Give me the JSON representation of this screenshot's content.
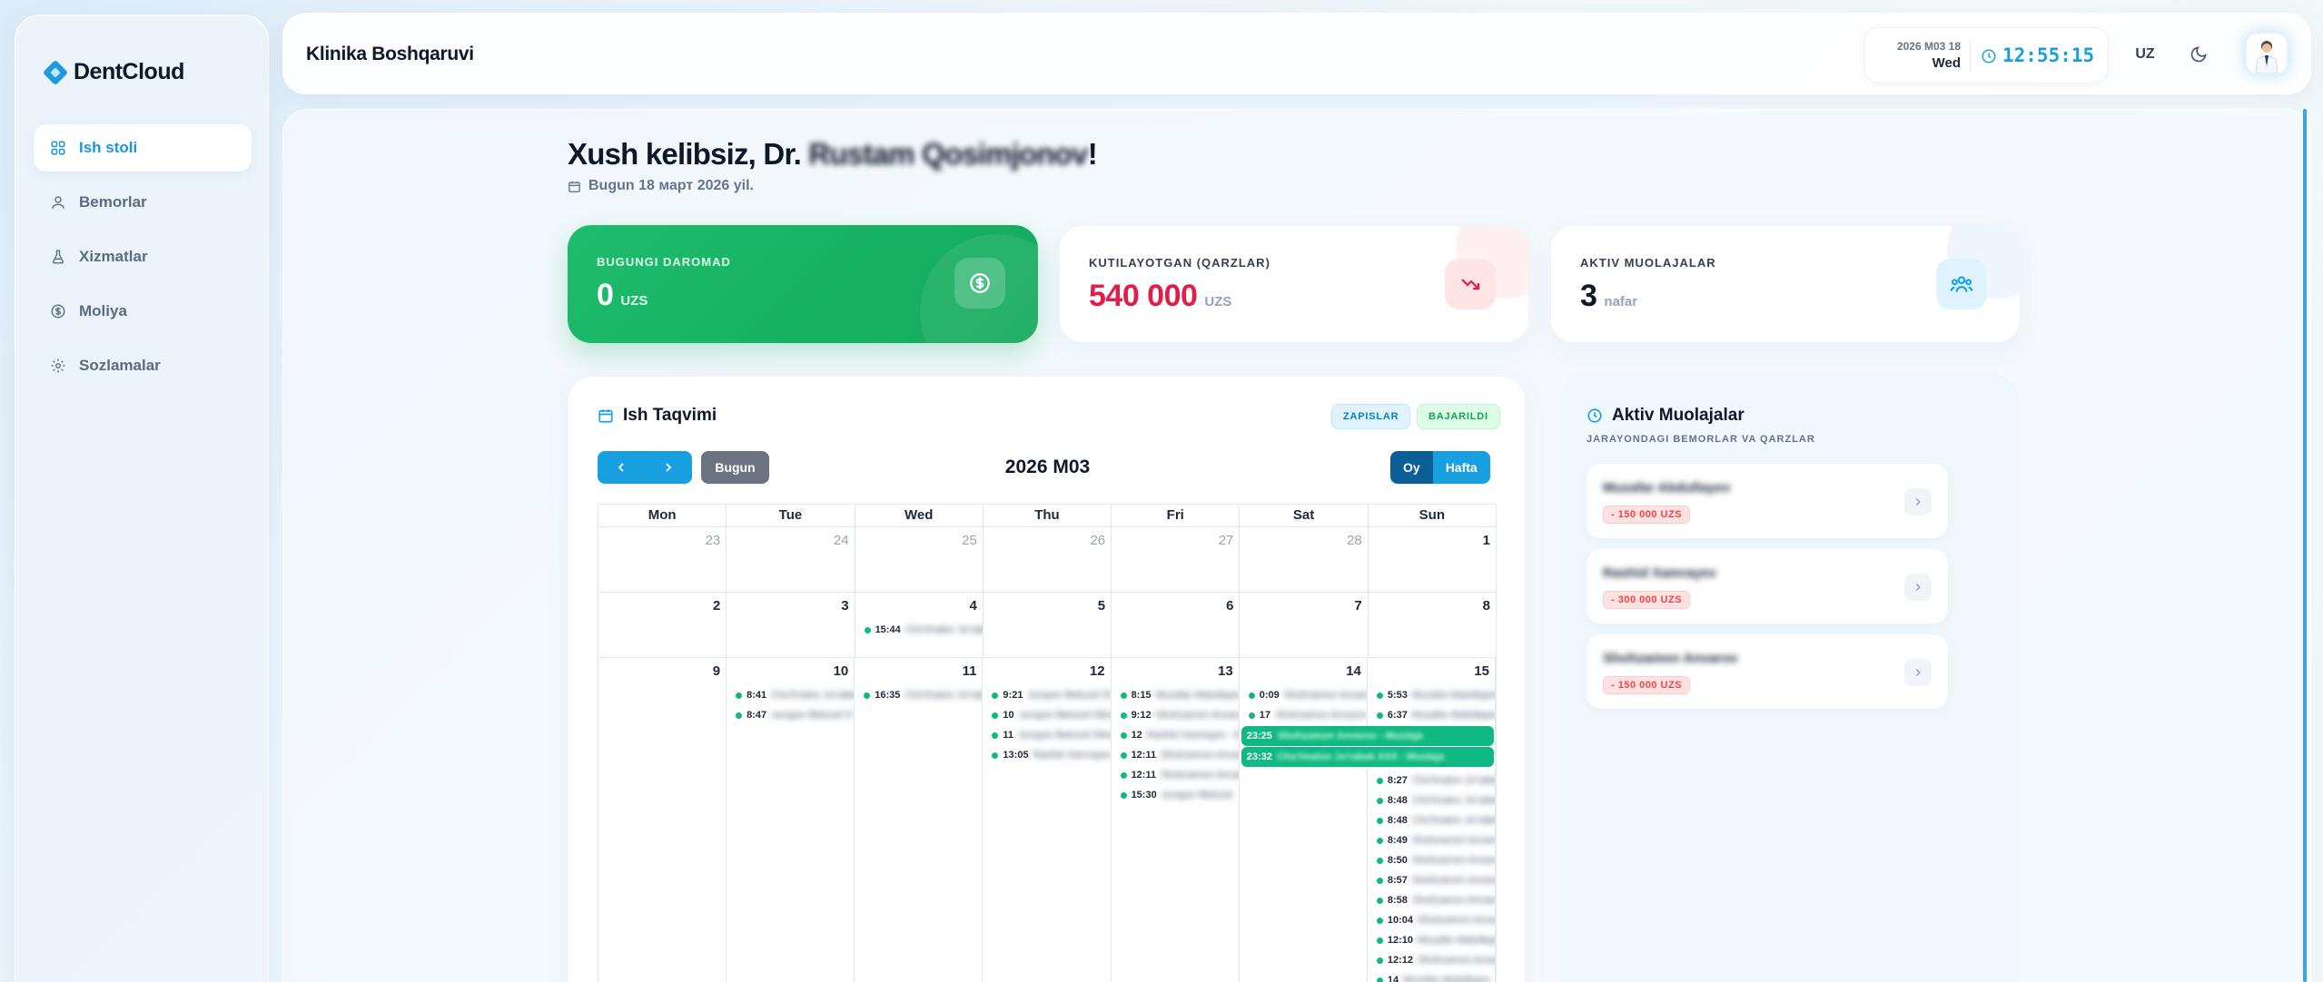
{
  "brand": {
    "name": "DentCloud"
  },
  "sidebar": {
    "items": [
      {
        "label": "Ish stoli",
        "icon": "dashboard-icon",
        "active": true
      },
      {
        "label": "Bemorlar",
        "icon": "users-icon"
      },
      {
        "label": "Xizmatlar",
        "icon": "flask-icon"
      },
      {
        "label": "Moliya",
        "icon": "dollar-icon"
      },
      {
        "label": "Sozlamalar",
        "icon": "gear-icon"
      }
    ]
  },
  "header": {
    "title": "Klinika Boshqaruvi",
    "date_line": "2026 M03 18",
    "weekday": "Wed",
    "time": "12:55:15",
    "lang": "UZ"
  },
  "welcome": {
    "prefix": "Xush kelibsiz, Dr. ",
    "name": "Rustam Qosimjonov",
    "suffix": "!",
    "today": "Bugun 18 март 2026 yil."
  },
  "stats": [
    {
      "label": "BUGUNGI DAROMAD",
      "value": "0",
      "unit": "UZS",
      "color": "#16b263"
    },
    {
      "label": "KUTILAYOTGAN (QARZLAR)",
      "value": "540 000",
      "unit": "UZS",
      "color": "#e11d48"
    },
    {
      "label": "AKTIV MUOLAJALAR",
      "value": "3",
      "unit": "nafar",
      "color": "#0f172a"
    }
  ],
  "calendar": {
    "title": "Ish Taqvimi",
    "legend_zapislar": "ZAPISLAR",
    "legend_bajarildi": "BAJARILDI",
    "today_btn": "Bugun",
    "month": "2026 M03",
    "view_month": "Oy",
    "view_week": "Hafta",
    "weekdays": [
      "Mon",
      "Tue",
      "Wed",
      "Thu",
      "Fri",
      "Sat",
      "Sun"
    ],
    "weeks": [
      {
        "days": [
          {
            "n": "23",
            "muted": true,
            "events": []
          },
          {
            "n": "24",
            "muted": true,
            "events": []
          },
          {
            "n": "25",
            "muted": true,
            "events": []
          },
          {
            "n": "26",
            "muted": true,
            "events": []
          },
          {
            "n": "27",
            "muted": true,
            "events": []
          },
          {
            "n": "28",
            "muted": true,
            "events": []
          },
          {
            "n": "1",
            "events": []
          }
        ]
      },
      {
        "days": [
          {
            "n": "2",
            "events": []
          },
          {
            "n": "3",
            "events": []
          },
          {
            "n": "4",
            "events": [
              {
                "t": "15:44",
                "n": "Cho'lmatov Jo'rabek"
              }
            ]
          },
          {
            "n": "5",
            "events": []
          },
          {
            "n": "6",
            "events": []
          },
          {
            "n": "7",
            "events": []
          },
          {
            "n": "8",
            "events": []
          }
        ]
      },
      {
        "days": [
          {
            "n": "9",
            "events": []
          },
          {
            "n": "10",
            "events": [
              {
                "t": "8:41",
                "n": "Cho'lmatov Jo'rabek"
              },
              {
                "t": "8:47",
                "n": "Jurayev Bekzod O"
              }
            ]
          },
          {
            "n": "11",
            "events": [
              {
                "t": "16:35",
                "n": "Cho'lmatov Jo'rabek"
              }
            ]
          },
          {
            "n": "12",
            "events": [
              {
                "t": "9:21",
                "n": "Jurayev Bekzod Ol"
              },
              {
                "t": "10",
                "n": "Jurayev Bekzod Olimovich"
              },
              {
                "t": "11",
                "n": "Jurayev Bekzod Olimovich"
              },
              {
                "t": "13:05",
                "n": "Rashid Xamrayev"
              }
            ]
          },
          {
            "n": "13",
            "events": [
              {
                "t": "8:15",
                "n": "Muzafar Abdullayev"
              },
              {
                "t": "9:12",
                "n": "Shohzamon Anvarov"
              },
              {
                "t": "12",
                "n": "Rashid Xamrayev - M"
              },
              {
                "t": "12:11",
                "n": "Shohzamon Anvarov"
              },
              {
                "t": "12:11",
                "n": "Shohzamon Anvarov"
              },
              {
                "t": "15:30",
                "n": "Jurayev Bekzod"
              }
            ]
          },
          {
            "n": "14",
            "events": [
              {
                "t": "0:09",
                "n": "Shohzamon Anvarov"
              },
              {
                "t": "17",
                "n": "Shohzamon Anvarov"
              }
            ]
          },
          {
            "n": "15",
            "events": [
              {
                "t": "5:53",
                "n": "Muzafar Abdullayev"
              },
              {
                "t": "6:37",
                "n": "Muzafar Abdullayev"
              }
            ]
          }
        ],
        "bars": [
          {
            "t": "23:25",
            "n": "Shohzamon Anvarov - Muolaja"
          },
          {
            "t": "23:32",
            "n": "Cho'lmatov Jo'rabek XXX - Muolaja"
          }
        ],
        "sun_more": [
          {
            "t": "8:27",
            "n": "Cho'lmatov Jo'rabek"
          },
          {
            "t": "8:48",
            "n": "Cho'lmatov Jo'rabek"
          },
          {
            "t": "8:48",
            "n": "Cho'lmatov Jo'rabek"
          },
          {
            "t": "8:49",
            "n": "Shohzamon Anvarov"
          },
          {
            "t": "8:50",
            "n": "Shohzamon Anvarov"
          },
          {
            "t": "8:57",
            "n": "Shohzamon Anvarov"
          },
          {
            "t": "8:58",
            "n": "Shohzamon Anvarov"
          },
          {
            "t": "10:04",
            "n": "Shohzamon Anvarov"
          },
          {
            "t": "12:10",
            "n": "Muzafar Abdullayev"
          },
          {
            "t": "12:12",
            "n": "Shohzamon Anvarov"
          },
          {
            "t": "14",
            "n": "Muzafar Abdullayev"
          }
        ]
      }
    ]
  },
  "active": {
    "title": "Aktiv Muolajalar",
    "subtitle": "JARAYONDAGI BEMORLAR VA QARZLAR",
    "items": [
      {
        "name": "Muzafar Abdullayev",
        "debt": "- 150 000 UZS"
      },
      {
        "name": "Rashid Xamrayev",
        "debt": "- 300 000 UZS"
      },
      {
        "name": "Shohzamon Anvarov",
        "debt": "- 150 000 UZS"
      }
    ]
  }
}
